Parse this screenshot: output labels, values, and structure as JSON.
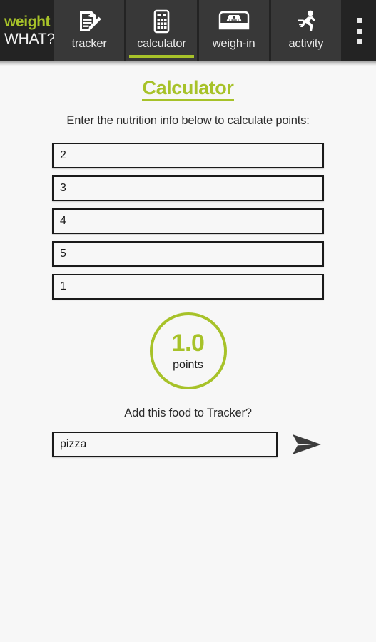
{
  "app": {
    "logo_line1": "weight",
    "logo_line2": "WHAT?",
    "accent_color": "#a7c229",
    "navbar_color": "#232323",
    "tab_color": "#383838",
    "background_color": "#f7f7f7"
  },
  "nav": {
    "tabs": [
      {
        "label": "tracker",
        "icon": "note-pencil-icon",
        "active": false
      },
      {
        "label": "calculator",
        "icon": "calculator-icon",
        "active": true
      },
      {
        "label": "weigh-in",
        "icon": "scale-icon",
        "active": false
      },
      {
        "label": "activity",
        "icon": "running-person-icon",
        "active": false
      }
    ],
    "overflow_icon": "overflow-menu-icon"
  },
  "main": {
    "title": "Calculator",
    "instructions": "Enter the nutrition info below to calculate points:",
    "nutrition_fields": [
      {
        "name": "field-1",
        "value": "2",
        "placeholder": ""
      },
      {
        "name": "field-2",
        "value": "3",
        "placeholder": ""
      },
      {
        "name": "field-3",
        "value": "4",
        "placeholder": ""
      },
      {
        "name": "field-4",
        "value": "5",
        "placeholder": ""
      },
      {
        "name": "field-5",
        "value": "1",
        "placeholder": ""
      }
    ],
    "result": {
      "value": "1.0",
      "label": "points"
    },
    "add_prompt": "Add this food to Tracker?",
    "food_name": {
      "value": "pizza",
      "placeholder": ""
    },
    "send_icon": "send-arrow-icon"
  }
}
